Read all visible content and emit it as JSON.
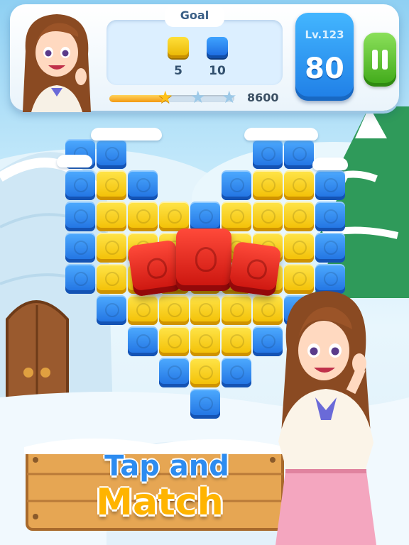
{
  "hud": {
    "goal_title": "Goal",
    "goals": [
      {
        "color": "yellow",
        "count": "5"
      },
      {
        "color": "blue",
        "count": "10"
      }
    ],
    "progress_fraction": 0.46,
    "stars_filled": 1,
    "stars_total": 3,
    "target_score": "8600",
    "level_label": "Lv.123",
    "moves_left": "80",
    "pause_icon": "pause-icon"
  },
  "banner": {
    "line1": "Tap and",
    "line2": "Match"
  },
  "colors": {
    "block_blue": "#2a86f0",
    "block_yellow": "#f7cc10",
    "block_red": "#e0231a",
    "pause_green": "#57c02a",
    "level_blue": "#2c93f3"
  },
  "board": {
    "rows": [
      "BB....BB.",
      "BYB..BYYB",
      "BYYYBYYYB",
      "BYY...YYB",
      "BYY...YYB",
      ".BYYYYYB.",
      "..BYYYB..",
      "...BYB...",
      "....B...."
    ],
    "red_blocks": 3
  }
}
